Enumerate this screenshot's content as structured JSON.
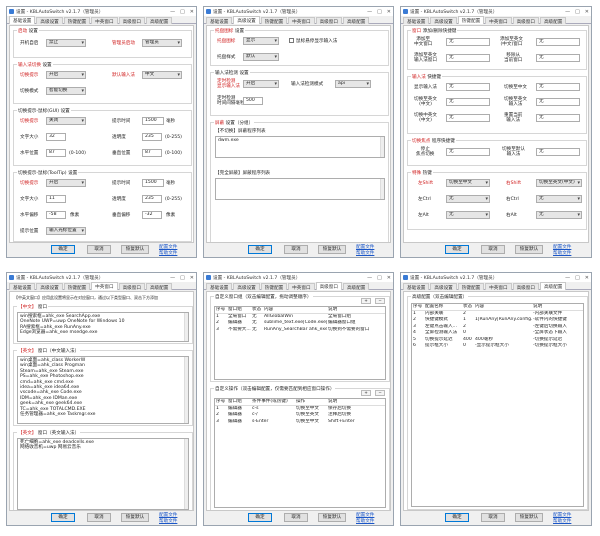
{
  "title": "设置 - KBLAutoSwitch v2.1.7（管理员）",
  "tabs": [
    "基础设置",
    "高级设置",
    "热键配置",
    "中英窗口",
    "高级窗口",
    "高级配置"
  ],
  "buttons": {
    "ok": "确定",
    "cancel": "取消",
    "restore": "恢复默认"
  },
  "links": {
    "config": "配置文件",
    "help": "帮助文件",
    "open_dir": "打开配置目录"
  },
  "w1": {
    "g1": "启动",
    "g1b": "设置",
    "autostart": "开机自启",
    "autostart_v": "禁止",
    "admin": "管理员启动",
    "admin_v": "管理员",
    "g2": "输入法切换",
    "g2b": "设置",
    "switch_tip": "切换提示",
    "switch_tip_v": "开启",
    "default_ime": "默认输入法",
    "default_ime_v": "中文",
    "switch_mode": "切换模式",
    "switch_mode_v": "智能切换",
    "g3": "切换提示-鼠标(GUI)",
    "g3b": "设置",
    "tip_style": "切换提示",
    "tip_style_v": "关闭",
    "tip_time": "提示时间",
    "tip_time_v": "1500",
    "tip_unit": "毫秒",
    "font_size": "文字大小",
    "font_size_v": "32",
    "transp": "透明度",
    "transp_v": "235",
    "transp_r": "(0-255)",
    "hpos": "水平位置",
    "hpos_v": "87",
    "hpos_r": "(0-100)",
    "vpos": "垂直位置",
    "vpos_v": "87",
    "vpos_r": "(0-100)",
    "g4": "切换提示-鼠标(ToolTip)",
    "g4b": "设置",
    "tt_style": "切换提示",
    "tt_style_v": "开启",
    "tt_time": "提示时间",
    "tt_time_v": "1500",
    "tt_unit": "毫秒",
    "tt_font": "文字大小",
    "tt_font_v": "11",
    "tt_transp": "透明度",
    "tt_transp_v": "235",
    "tt_transp_r": "(0-255)",
    "tt_h": "水平偏移",
    "tt_h_v": "-58",
    "tt_h_u": "像素",
    "tt_v": "垂直偏移",
    "tt_v_v": "-32",
    "tt_v_u": "像素",
    "tt_pos": "提示位置",
    "tt_pos_v": "输入光标位置"
  },
  "w2": {
    "g1": "托盘图标",
    "g1b": "设置",
    "tray_show": "托盘图标",
    "tray_show_v": "显示",
    "tray_tip": "鼠标悬停显示输入法",
    "tray_style": "托盘样式",
    "tray_style_v": "默认",
    "g2": "输入法检测",
    "g2b": "设置",
    "detect": "定时检测\n显示输入法",
    "detect_v": "开启",
    "detect_mode": "输入法检测模式",
    "detect_mode_v": "api",
    "detect_int": "定时检测\n时间间隔毫秒",
    "detect_int_v": "500",
    "g3": "屏蔽",
    "g3b": "设置（分组）",
    "sub1": "【不切换】屏蔽程序列表",
    "list1": [
      "dwm.exe"
    ],
    "sub2": "【完全屏蔽】屏蔽程序列表"
  },
  "w3": {
    "g1": "窗口",
    "g1b": "添加/删除快捷键",
    "k1": "添加至\n中文窗口",
    "k1v": "无",
    "k2": "添加至英文\n(中文)窗口",
    "k2v": "无",
    "k3": "添加至英文\n输入法窗口",
    "k3v": "无",
    "k4": "移除从\n当前窗口",
    "k4v": "无",
    "g2": "输入法",
    "g2b": "快捷键",
    "k5": "显示输入法",
    "k5v": "无",
    "k6": "切换至中文",
    "k6v": "无",
    "k7": "切换至英文\n(中文)",
    "k7v": "无",
    "k8": "切换至英文\n输入法",
    "k8v": "无",
    "k9": "切换中英文\n(中文)",
    "k9v": "无",
    "k10": "重置当前\n输入法",
    "k10v": "无",
    "g3": "切换焦点",
    "g3b": "程序快捷键",
    "k11": "停止\n焦点切换",
    "k11v": "无",
    "k12": "切换至默认\n输入法",
    "k12v": "无",
    "g4": "特殊",
    "g4b": "热键",
    "s1": "左Shift",
    "s1v": "切换至中文",
    "s2": "右Shift",
    "s2v": "切换至英文(中文)",
    "s3": "左Ctrl",
    "s3v": "无",
    "s4": "右Ctrl",
    "s4v": "无",
    "s5": "左Alt",
    "s5v": "无",
    "s6": "右Alt",
    "s6v": "无"
  },
  "w4": {
    "head": "【中英文窗口】应用此设置将显示在对应窗口，通过以下类型窗口、双击下方添加",
    "g1": "【中文】",
    "g1b": "窗口",
    "list1": [
      "win搜索框=ahk_exe SearchApp.exe",
      "OneNote UWP=uwp OneNote for Windows 10",
      "RA搜索框=ahk_exe RunAny.exe",
      "Edge浏览器=ahk_exe msedge.exe"
    ],
    "g2": "【英文】",
    "g2b": "窗口（中文输入法）",
    "list2": [
      "win桌面=ahk_class WorkerW",
      "win桌面=ahk_class Progman",
      "Steam=ahk_exe Steam.exe",
      "PS=ahk_exe Photoshop.exe",
      "cmd=ahk_exe cmd.exe",
      "idea=ahk_exe idea64.exe",
      "vscode=ahk_exe Code.exe",
      "IDM=ahk_exe IDMan.exe",
      "geek=ahk_exe geek64.exe",
      "TC=ahk_exe TOTALCMD.EXE",
      "任务管理器=ahk_exe Taskmgr.exe"
    ],
    "g3": "【英文】",
    "g3b": "窗口（英文输入法）",
    "list3": [
      "死亡细胞=ahk_exe deadcells.exe",
      "网络收音机=uwp 网易云音乐"
    ]
  },
  "w5": {
    "g1": "自定义窗口组",
    "g1b": "（双击编辑配置，拖动调整顺序）",
    "cols1": [
      "序号",
      "窗口组",
      "状态",
      "内容",
      "说明"
    ],
    "rows1": [
      [
        "1",
        "全局窗口",
        "无",
        "AllGlobalWin",
        "全局窗口组"
      ],
      [
        "2",
        "编辑器",
        "无",
        "sublime_text.exe|Code.exe|vim...",
        "编辑器窗口组"
      ],
      [
        "3",
        "不需要大...",
        "无",
        "RunAny_SearchBar ahk_exe...",
        "切换到不需要的窗口"
      ]
    ],
    "g2": "自定义操作",
    "g2b": "（双击编辑配置，仅需要匹配到相应窗口操作）",
    "cols2": [
      "序号",
      "窗口组",
      "条件事件(或热键)",
      "操作",
      "说明"
    ],
    "rows2": [
      [
        "1",
        "编辑器",
        "c-s",
        "切换至中文",
        "保存后切换"
      ],
      [
        "2",
        "编辑器",
        "c-/",
        "切换至英文",
        "注释后切换"
      ],
      [
        "3",
        "编辑器",
        "s-Enter",
        "切换至中文",
        "Shift+Enter"
      ]
    ]
  },
  "w6": {
    "g1": "高级配置",
    "g1b": "（双击编辑配置）",
    "cols": [
      "序号",
      "配置名称",
      "状态",
      "内容",
      "说明"
    ],
    "rows": [
      [
        "1",
        "内部关联",
        "2",
        "",
        "-内部关联文件"
      ],
      [
        "2",
        "快捷键模式",
        "1",
        "1|RunAny|RunAny.config.ini",
        "-软件内的快捷键"
      ],
      [
        "3",
        "左键点击输入...",
        "2",
        "",
        "-左键后切换输入"
      ],
      [
        "4",
        "全屏检测输入法",
        "0",
        "",
        "-全屏状态下输入"
      ],
      [
        "5",
        "切换提示延迟",
        "400",
        "400毫秒",
        "-切换提示延迟"
      ],
      [
        "6",
        "提示框大小",
        "0",
        "-显示提示框大小",
        "-切换提示框大小"
      ]
    ]
  }
}
